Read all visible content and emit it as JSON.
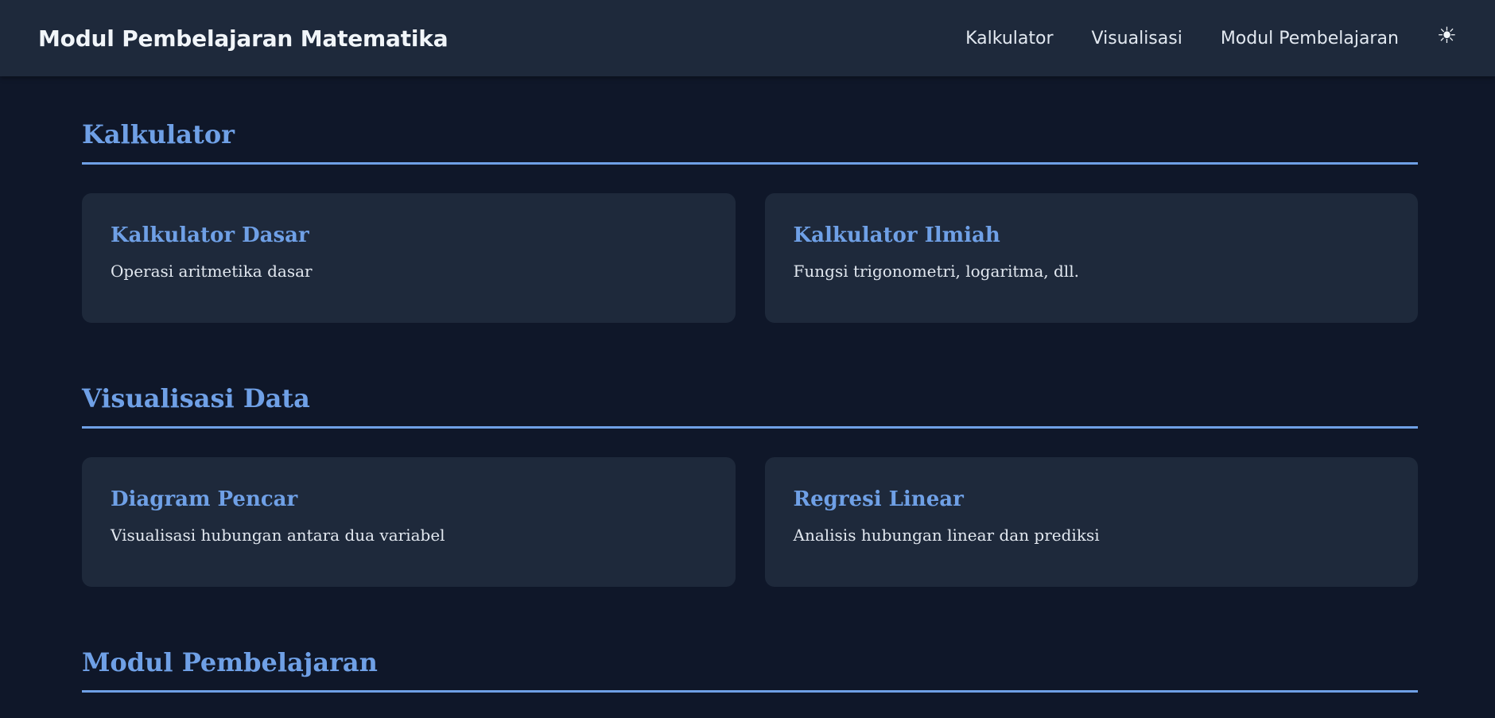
{
  "navbar": {
    "brand": "Modul Pembelajaran Matematika",
    "links": [
      "Kalkulator",
      "Visualisasi",
      "Modul Pembelajaran"
    ],
    "theme_icon": "☀"
  },
  "sections": [
    {
      "title": "Kalkulator",
      "cards": [
        {
          "title": "Kalkulator Dasar",
          "desc": "Operasi aritmetika dasar"
        },
        {
          "title": "Kalkulator Ilmiah",
          "desc": "Fungsi trigonometri, logaritma, dll."
        }
      ]
    },
    {
      "title": "Visualisasi Data",
      "cards": [
        {
          "title": "Diagram Pencar",
          "desc": "Visualisasi hubungan antara dua variabel"
        },
        {
          "title": "Regresi Linear",
          "desc": "Analisis hubungan linear dan prediksi"
        }
      ]
    },
    {
      "title": "Modul Pembelajaran"
    }
  ],
  "colors": {
    "background": "#0f1729",
    "surface": "#1e293b",
    "accent": "#6fa0e6",
    "text": "#e2e8f0"
  }
}
